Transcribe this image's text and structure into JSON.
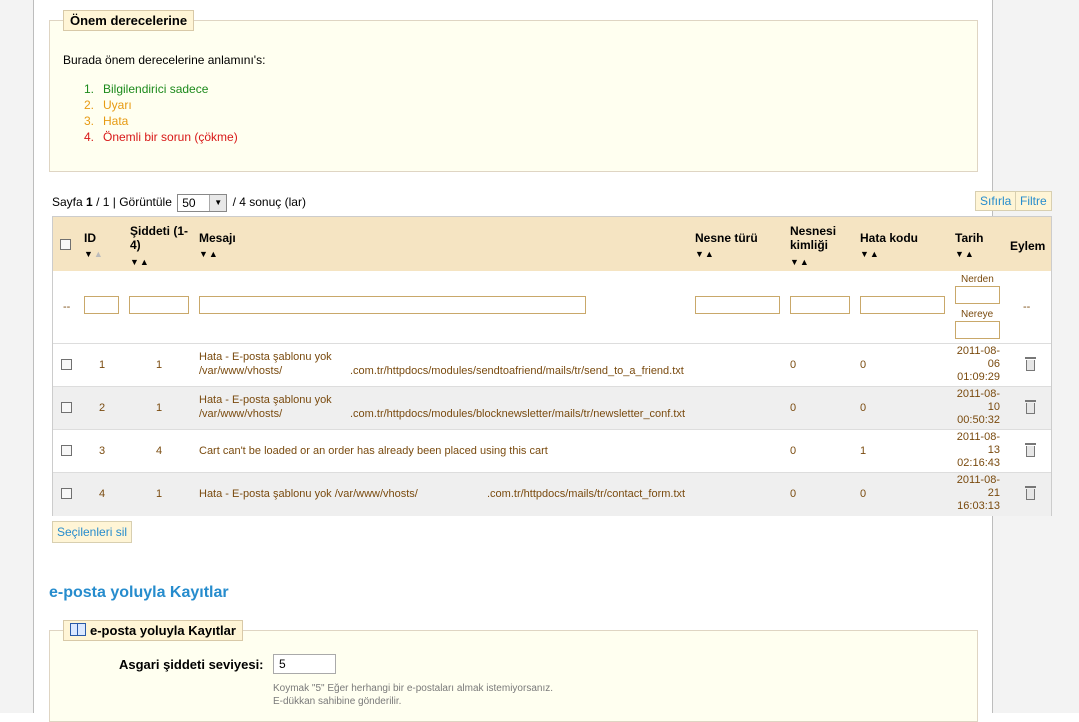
{
  "severity": {
    "legend": "Önem derecelerine",
    "intro": "Burada önem derecelerine anlamını's:",
    "levels": [
      {
        "num": "1.",
        "label": "Bilgilendirici sadece",
        "color": "#1c8a1c"
      },
      {
        "num": "2.",
        "label": "Uyarı",
        "color": "#e79a12"
      },
      {
        "num": "3.",
        "label": "Hata",
        "color": "#e79a12"
      },
      {
        "num": "4.",
        "label": "Önemli bir sorun (çökme)",
        "color": "#d81818"
      }
    ]
  },
  "pager": {
    "prefix": "Sayfa",
    "page": "1",
    "total_pages": "/ 1 | Görüntüle",
    "per_page": "50",
    "result_text": "/ 4 sonuç (lar)"
  },
  "toolbar": {
    "reset": "Sıfırla",
    "filter": "Filtre"
  },
  "columns": {
    "id": "ID",
    "severity": "Şiddeti (1-4)",
    "message": "Mesajı",
    "object_type": "Nesne türü",
    "object_id": "Nesnesi kimliği",
    "error_code": "Hata kodu",
    "date": "Tarih",
    "action": "Eylem"
  },
  "filters": {
    "placeholder_dash": "--",
    "from": "Nerden",
    "to": "Nereye",
    "action_dash": "--"
  },
  "rows": [
    {
      "id": "1",
      "severity": "1",
      "message_line1": "Hata - E-posta şablonu yok",
      "message_line2": "/var/www/vhosts/",
      "message_line3": ".com.tr/httpdocs/modules/sendtoafriend/mails/tr/send_to_a_friend.txt",
      "object_type": "",
      "object_id": "0",
      "error_code": "0",
      "date1": "2011-08-",
      "date2": "06",
      "time": "01:09:29"
    },
    {
      "id": "2",
      "severity": "1",
      "message_line1": "Hata - E-posta şablonu yok",
      "message_line2": "/var/www/vhosts/",
      "message_line3": ".com.tr/httpdocs/modules/blocknewsletter/mails/tr/newsletter_conf.txt",
      "object_type": "",
      "object_id": "0",
      "error_code": "0",
      "date1": "2011-08-",
      "date2": "10",
      "time": "00:50:32"
    },
    {
      "id": "3",
      "severity": "4",
      "message_line1": "Cart can't be loaded or an order has already been placed using this cart",
      "message_line2": "",
      "message_line3": "",
      "object_type": "",
      "object_id": "0",
      "error_code": "1",
      "date1": "2011-08-",
      "date2": "13",
      "time": "02:16:43"
    },
    {
      "id": "4",
      "severity": "1",
      "message_line1": "Hata - E-posta şablonu yok /var/www/vhosts/",
      "message_line2": "",
      "message_line3": ".com.tr/httpdocs/mails/tr/contact_form.txt",
      "object_type": "",
      "object_id": "0",
      "error_code": "0",
      "date1": "2011-08-",
      "date2": "21",
      "time": "16:03:13"
    }
  ],
  "delete_selected": "Seçilenleri sil",
  "email_section": {
    "title": "e-posta yoluyla Kayıtlar",
    "legend": "e-posta yoluyla Kayıtlar",
    "min_label": "Asgari şiddeti seviyesi:",
    "min_value": "5",
    "hint1": "Koymak \"5\" Eğer herhangi bir e-postaları almak istemiyorsanız.",
    "hint2": "E-dükkan sahibine gönderilir."
  }
}
